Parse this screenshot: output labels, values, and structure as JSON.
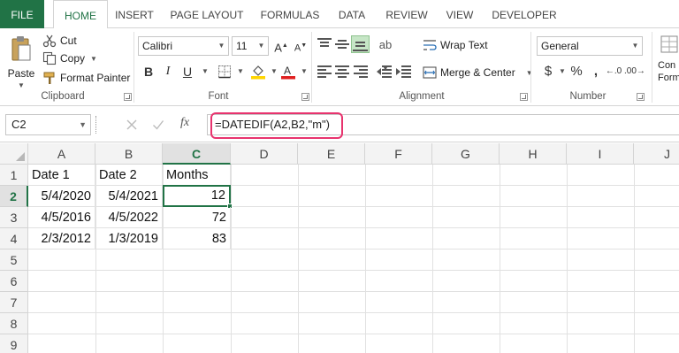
{
  "ribbon_tabs": [
    "FILE",
    "HOME",
    "INSERT",
    "PAGE LAYOUT",
    "FORMULAS",
    "DATA",
    "REVIEW",
    "VIEW",
    "DEVELOPER"
  ],
  "clipboard": {
    "paste": "Paste",
    "cut": "Cut",
    "copy": "Copy",
    "format_painter": "Format Painter",
    "group": "Clipboard"
  },
  "font": {
    "name": "Calibri",
    "size": "11",
    "group": "Font"
  },
  "alignment": {
    "wrap_text": "Wrap Text",
    "merge_center": "Merge & Center",
    "group": "Alignment"
  },
  "number": {
    "format": "General",
    "group": "Number",
    "currency_symbol": "$",
    "percent_symbol": "%"
  },
  "styles_partial": {
    "line1": "Con",
    "line2": "Form"
  },
  "formula_bar": {
    "name_box": "C2",
    "fx": "fx",
    "formula": "=DATEDIF(A2,B2,\"m\")"
  },
  "grid": {
    "columns": [
      "A",
      "B",
      "C",
      "D",
      "E",
      "F",
      "G",
      "H",
      "I",
      "J"
    ],
    "active_column": "C",
    "active_row": 2,
    "rows": [
      {
        "num": "1",
        "cells": [
          "Date 1",
          "Date 2",
          "Months"
        ]
      },
      {
        "num": "2",
        "cells": [
          "5/4/2020",
          "5/4/2021",
          "12"
        ]
      },
      {
        "num": "3",
        "cells": [
          "4/5/2016",
          "4/5/2022",
          "72"
        ]
      },
      {
        "num": "4",
        "cells": [
          "2/3/2012",
          "1/3/2019",
          "83"
        ]
      },
      {
        "num": "5",
        "cells": [
          "",
          "",
          ""
        ]
      },
      {
        "num": "6",
        "cells": [
          "",
          "",
          ""
        ]
      },
      {
        "num": "7",
        "cells": [
          "",
          "",
          ""
        ]
      },
      {
        "num": "8",
        "cells": [
          "",
          "",
          ""
        ]
      },
      {
        "num": "9",
        "cells": [
          "",
          "",
          ""
        ]
      }
    ]
  },
  "colors": {
    "excel_green": "#217346",
    "highlight": "#e8336e",
    "fill_yellow": "#ffd500",
    "font_red": "#e02020"
  }
}
